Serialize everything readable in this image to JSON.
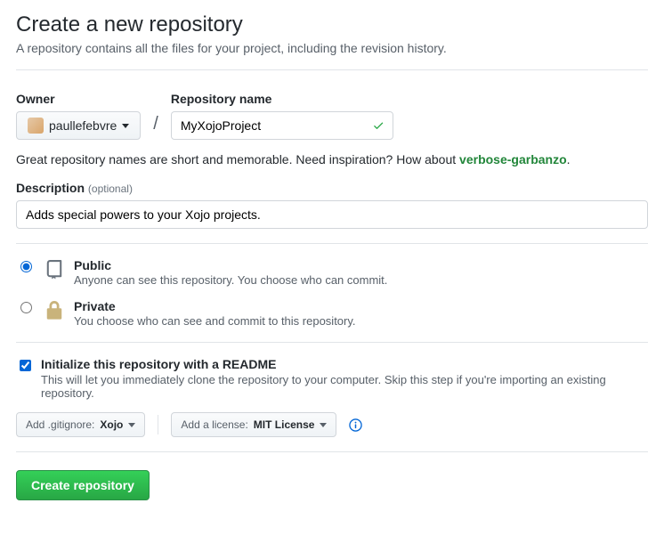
{
  "page": {
    "title": "Create a new repository",
    "subtitle": "A repository contains all the files for your project, including the revision history."
  },
  "owner": {
    "label": "Owner",
    "selected": "paullefebvre"
  },
  "repo": {
    "label": "Repository name",
    "value": "MyXojoProject"
  },
  "hint": {
    "text_before": "Great repository names are short and memorable. Need inspiration? How about ",
    "suggestion": "verbose-garbanzo",
    "text_after": "."
  },
  "description": {
    "label": "Description",
    "optional": "(optional)",
    "value": "Adds special powers to your Xojo projects."
  },
  "visibility": {
    "public": {
      "title": "Public",
      "desc": "Anyone can see this repository. You choose who can commit."
    },
    "private": {
      "title": "Private",
      "desc": "You choose who can see and commit to this repository."
    }
  },
  "init": {
    "title": "Initialize this repository with a README",
    "desc": "This will let you immediately clone the repository to your computer. Skip this step if you're importing an existing repository."
  },
  "options": {
    "gitignore_prefix": "Add .gitignore: ",
    "gitignore_value": "Xojo",
    "license_prefix": "Add a license: ",
    "license_value": "MIT License"
  },
  "submit": {
    "label": "Create repository"
  }
}
